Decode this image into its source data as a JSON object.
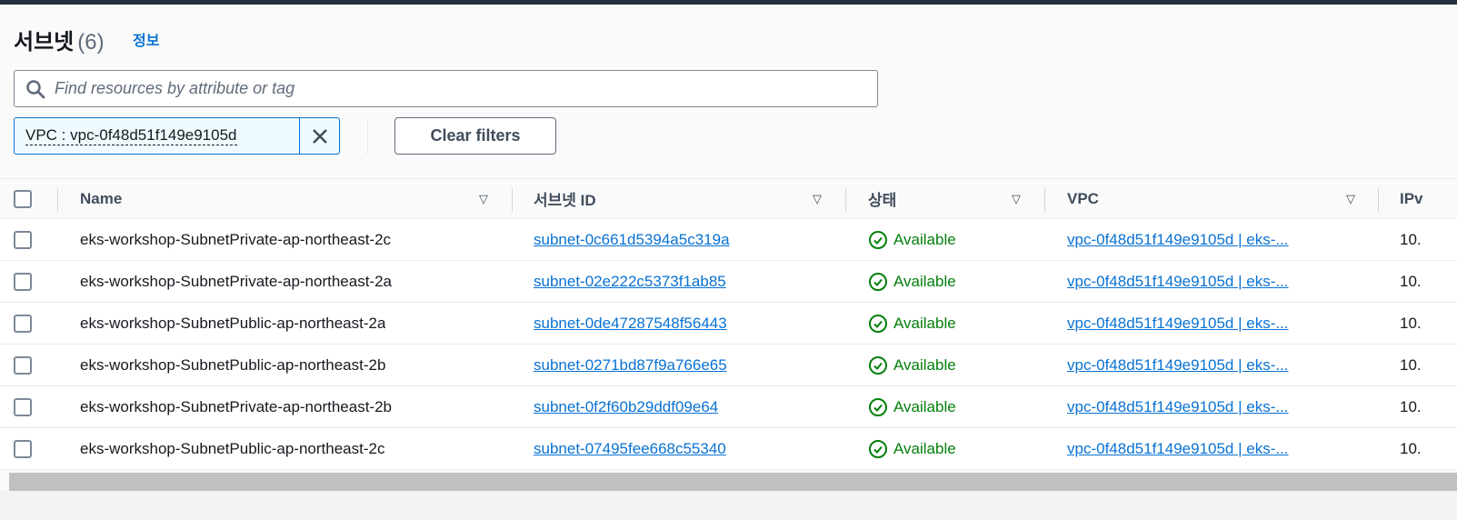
{
  "header": {
    "title": "서브넷",
    "count": "(6)",
    "info": "정보"
  },
  "search": {
    "placeholder": "Find resources by attribute or tag"
  },
  "filter": {
    "chip": "VPC : vpc-0f48d51f149e9105d",
    "clear": "Clear filters"
  },
  "columns": [
    "Name",
    "서브넷 ID",
    "상태",
    "VPC",
    "IPv"
  ],
  "rows": [
    {
      "name": "eks-workshop-SubnetPrivate-ap-northeast-2c",
      "id": "subnet-0c661d5394a5c319a",
      "status": "Available",
      "vpc": "vpc-0f48d51f149e9105d | eks-...",
      "ip": "10."
    },
    {
      "name": "eks-workshop-SubnetPrivate-ap-northeast-2a",
      "id": "subnet-02e222c5373f1ab85",
      "status": "Available",
      "vpc": "vpc-0f48d51f149e9105d | eks-...",
      "ip": "10."
    },
    {
      "name": "eks-workshop-SubnetPublic-ap-northeast-2a",
      "id": "subnet-0de47287548f56443",
      "status": "Available",
      "vpc": "vpc-0f48d51f149e9105d | eks-...",
      "ip": "10."
    },
    {
      "name": "eks-workshop-SubnetPublic-ap-northeast-2b",
      "id": "subnet-0271bd87f9a766e65",
      "status": "Available",
      "vpc": "vpc-0f48d51f149e9105d | eks-...",
      "ip": "10."
    },
    {
      "name": "eks-workshop-SubnetPrivate-ap-northeast-2b",
      "id": "subnet-0f2f60b29ddf09e64",
      "status": "Available",
      "vpc": "vpc-0f48d51f149e9105d | eks-...",
      "ip": "10."
    },
    {
      "name": "eks-workshop-SubnetPublic-ap-northeast-2c",
      "id": "subnet-07495fee668c55340",
      "status": "Available",
      "vpc": "vpc-0f48d51f149e9105d | eks-...",
      "ip": "10."
    }
  ]
}
